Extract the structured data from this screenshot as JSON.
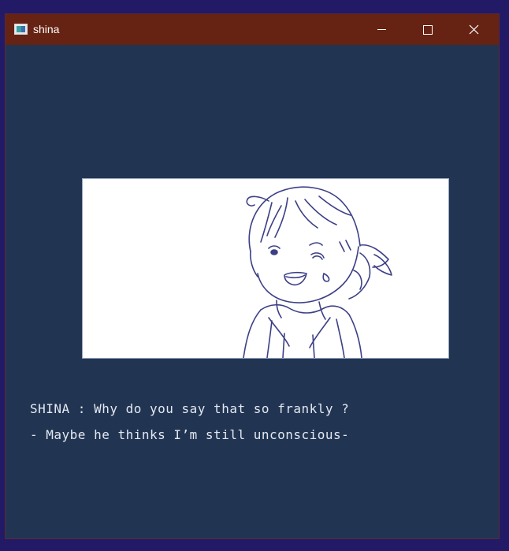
{
  "window": {
    "title": "shina"
  },
  "title_bar": {
    "icon": "app-icon",
    "controls": [
      "minimize-icon",
      "maximize-icon",
      "close-icon"
    ]
  },
  "scene": {
    "character": "SHINA",
    "image": "character-sketch"
  },
  "dialogue": {
    "line1": "SHINA : Why do you say that so frankly ?",
    "line2": "- Maybe he thinks I’m still unconscious-"
  },
  "colors": {
    "desktop": "#221a66",
    "title_bar": "#662213",
    "game_background": "#213552",
    "text": "#e4e8f2",
    "sketch_ink": "#3c3f86"
  }
}
